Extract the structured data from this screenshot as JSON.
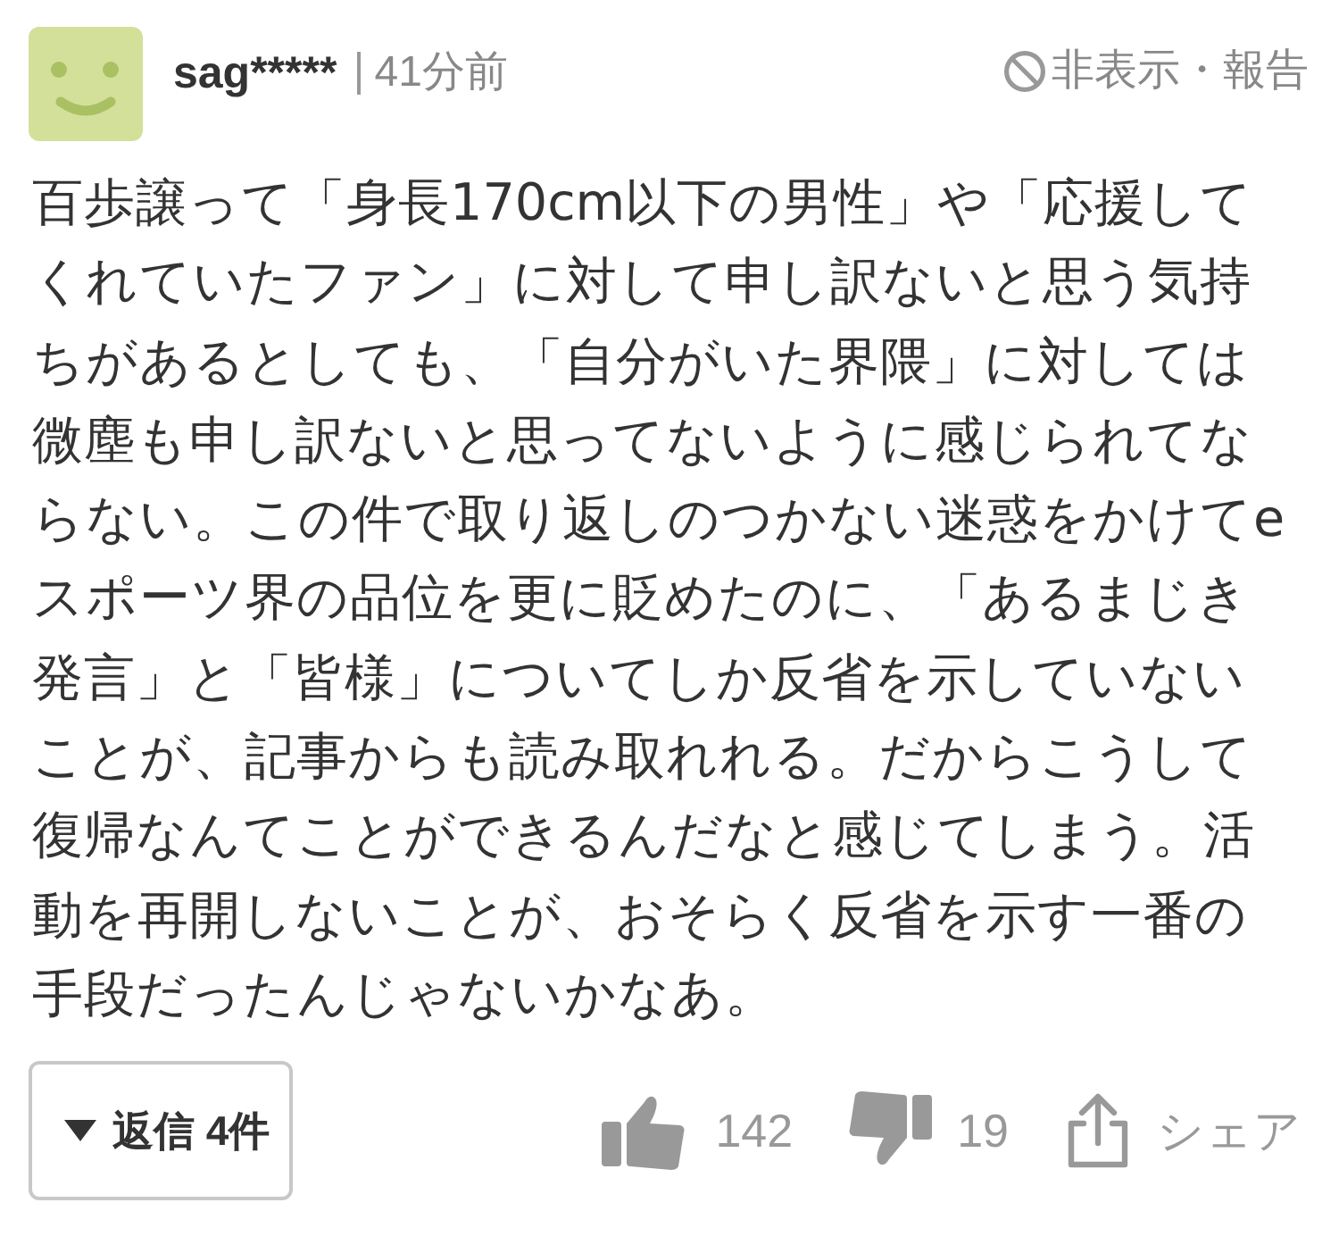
{
  "header": {
    "username": "sag*****",
    "time": "41分前",
    "hide_report": "非表示・報告"
  },
  "body": "百歩譲って「身長170cm以下の男性」や「応援してくれていたファン」に対して申し訳ないと思う気持ちがあるとしても、「自分がいた界隈」に対しては微塵も申し訳ないと思ってないように感じられてならない。この件で取り返しのつかない迷惑をかけてeスポーツ界の品位を更に貶めたのに、「あるまじき発言」と「皆様」についてしか反省を示していないことが、記事からも読み取れれる。だからこうして復帰なんてことができるんだなと感じてしまう。活動を再開しないことが、おそらく反省を示す一番の手段だったんじゃないかなあ。",
  "footer": {
    "reply_button": "返信 4件",
    "likes": "142",
    "dislikes": "19",
    "share": "シェア"
  }
}
